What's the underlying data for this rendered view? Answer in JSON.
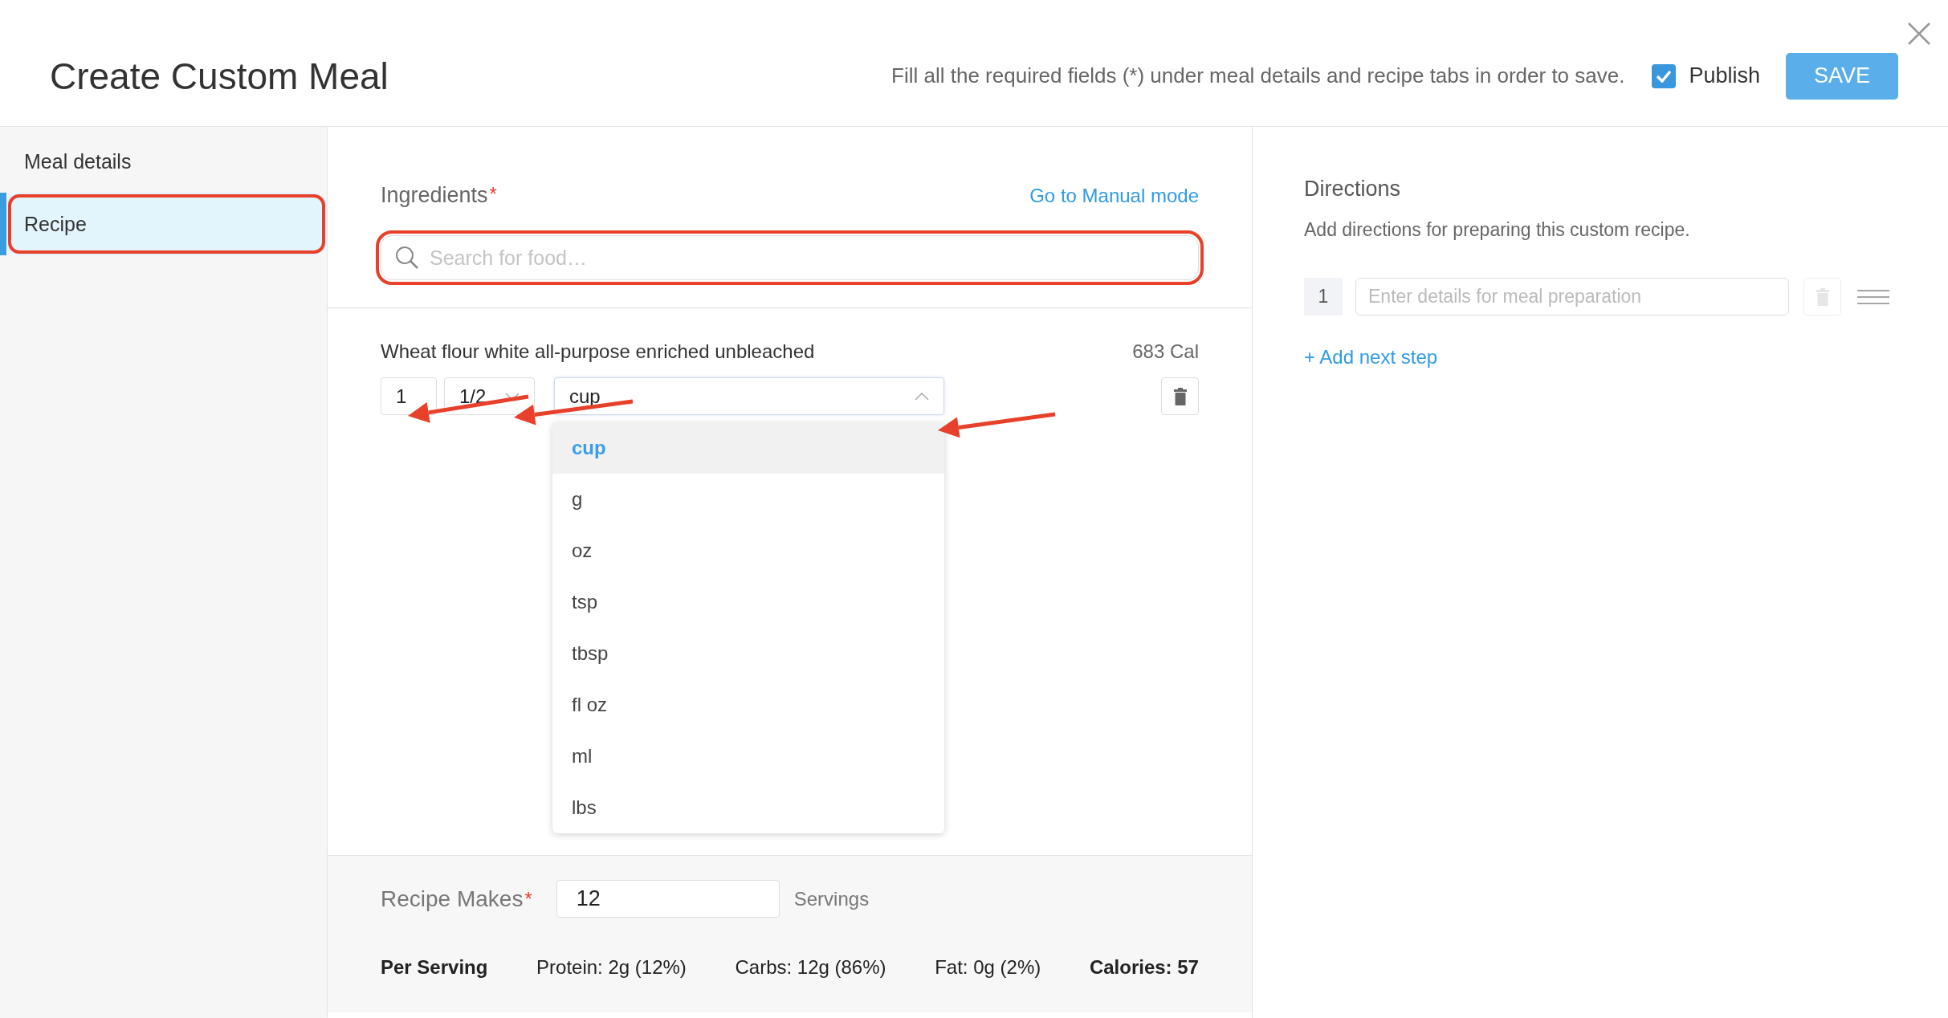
{
  "dialog": {
    "title": "Create Custom Meal",
    "hint": "Fill all the required fields (*) under meal details and recipe tabs in order to save.",
    "publish": {
      "label": "Publish",
      "checked": true
    },
    "save_button": "SAVE"
  },
  "sidebar": {
    "items": [
      {
        "label": "Meal details",
        "selected": false,
        "annotated": false
      },
      {
        "label": "Recipe",
        "selected": true,
        "annotated": true
      }
    ]
  },
  "ingredients": {
    "title": "Ingredients",
    "required_mark": "*",
    "manual_link": "Go to Manual mode",
    "search": {
      "placeholder": "Search for food…",
      "annotated": true
    },
    "items": [
      {
        "name": "Wheat flour white all-purpose enriched unbleached",
        "calories": "683 Cal",
        "quantity": {
          "value": "1",
          "annotated": true
        },
        "fraction": {
          "value": "1/2",
          "annotated": true
        },
        "unit": {
          "value": "cup",
          "annotated": true,
          "expanded": true,
          "options": [
            {
              "label": "cup",
              "selected": true
            },
            {
              "label": "g",
              "selected": false
            },
            {
              "label": "oz",
              "selected": false
            },
            {
              "label": "tsp",
              "selected": false
            },
            {
              "label": "tbsp",
              "selected": false
            },
            {
              "label": "fl oz",
              "selected": false
            },
            {
              "label": "ml",
              "selected": false
            },
            {
              "label": "lbs",
              "selected": false
            }
          ]
        }
      }
    ]
  },
  "recipe_makes": {
    "label": "Recipe Makes",
    "required_mark": "*",
    "value": "12",
    "unit": "Servings"
  },
  "per_serving": {
    "label": "Per Serving",
    "protein": "Protein: 2g (12%)",
    "carbs": "Carbs: 12g (86%)",
    "fat": "Fat: 0g (2%)",
    "calories": "Calories: 57"
  },
  "directions": {
    "title": "Directions",
    "description": "Add directions for preparing this custom recipe.",
    "steps": [
      {
        "number": "1",
        "placeholder": "Enter details for meal preparation"
      }
    ],
    "add_step": "+ Add next step"
  }
}
